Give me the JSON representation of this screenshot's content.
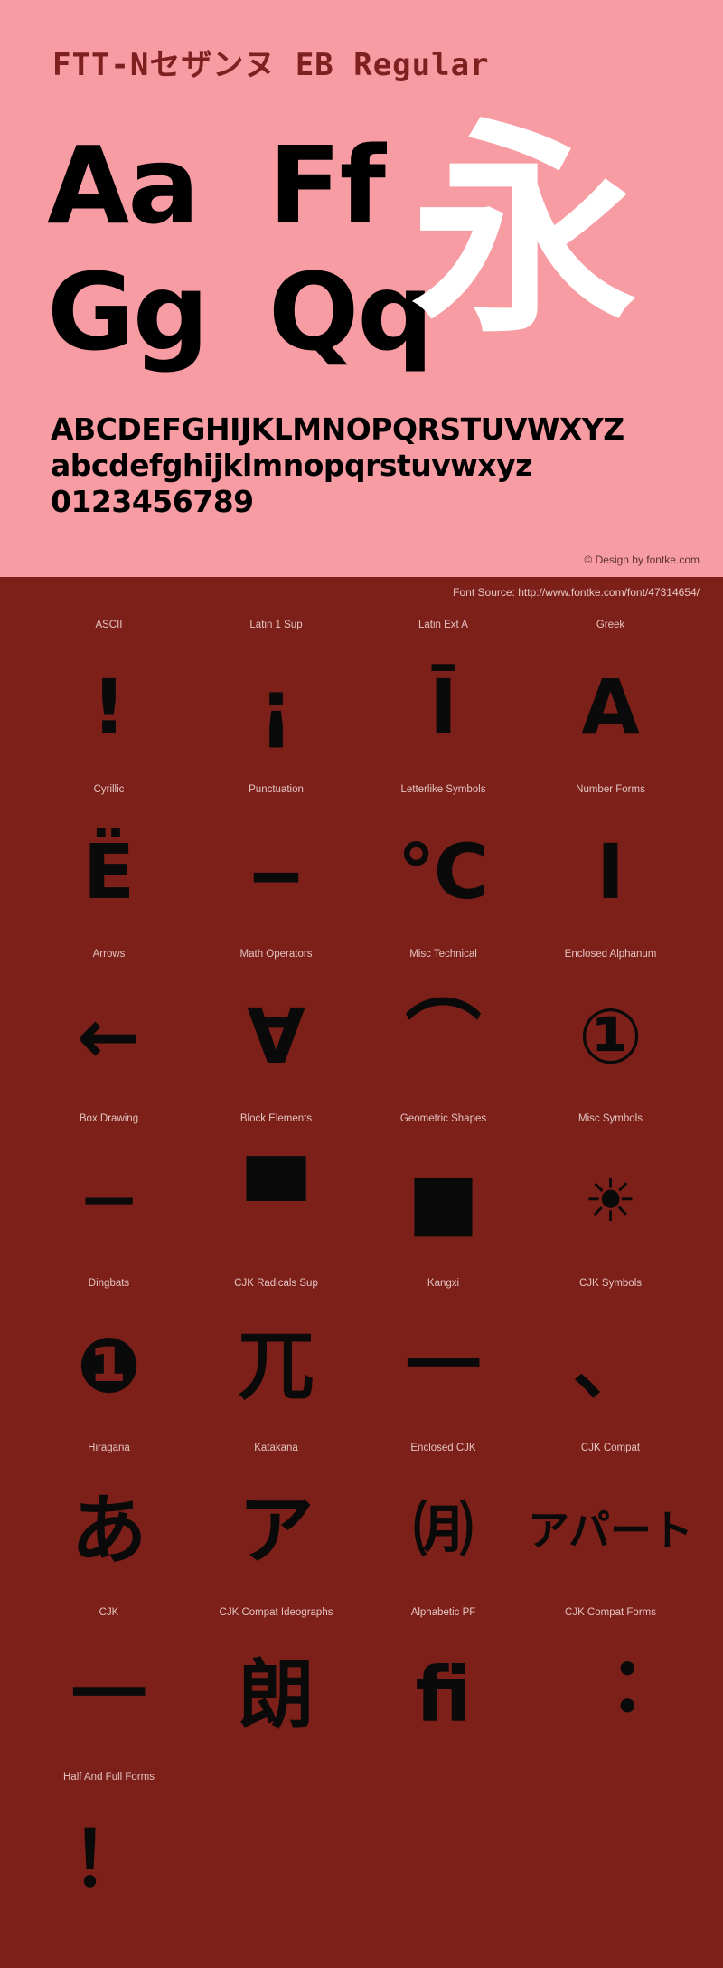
{
  "specimen": {
    "title": "FTT-Nセザンヌ EB Regular",
    "samples": [
      {
        "pair1": "Aa",
        "pair2": "Ff"
      },
      {
        "pair1": "Gg",
        "pair2": "Qq"
      }
    ],
    "cjk_sample": "永",
    "uppercase": "ABCDEFGHIJKLMNOPQRSTUVWXYZ",
    "lowercase": "abcdefghijklmnopqrstuvwxyz",
    "digits": "0123456789",
    "copyright": "© Design by fontke.com",
    "colors": {
      "background": "#f79ca3",
      "title_text": "#7e2020",
      "glyph_black": "#000000",
      "glyph_white": "#ffffff"
    }
  },
  "blocks_section": {
    "font_source": "Font Source: http://www.fontke.com/font/47314654/",
    "colors": {
      "background": "#7c2019",
      "label_text": "#e3c3c1",
      "glyph": "#0a0a0a"
    },
    "cells": [
      {
        "label": "ASCII",
        "glyph": "!",
        "size": "normal"
      },
      {
        "label": "Latin 1 Sup",
        "glyph": "¡",
        "size": "normal"
      },
      {
        "label": "Latin Ext A",
        "glyph": "Ī",
        "size": "normal"
      },
      {
        "label": "Greek",
        "glyph": "Α",
        "size": "normal"
      },
      {
        "label": "Cyrillic",
        "glyph": "Ё",
        "size": "normal"
      },
      {
        "label": "Punctuation",
        "glyph": "‒",
        "size": "normal"
      },
      {
        "label": "Letterlike Symbols",
        "glyph": "℃",
        "size": "normal"
      },
      {
        "label": "Number Forms",
        "glyph": "Ⅰ",
        "size": "normal"
      },
      {
        "label": "Arrows",
        "glyph": "←",
        "size": "normal"
      },
      {
        "label": "Math Operators",
        "glyph": "∀",
        "size": "normal"
      },
      {
        "label": "Misc Technical",
        "glyph": "⌒",
        "size": "normal"
      },
      {
        "label": "Enclosed Alphanum",
        "glyph": "①",
        "size": "normal"
      },
      {
        "label": "Box Drawing",
        "glyph": "─",
        "size": "normal"
      },
      {
        "label": "Block Elements",
        "glyph": "▀",
        "size": "normal"
      },
      {
        "label": "Geometric Shapes",
        "glyph": "■",
        "size": "normal"
      },
      {
        "label": "Misc Symbols",
        "glyph": "☀",
        "size": "smaller"
      },
      {
        "label": "Dingbats",
        "glyph": "❶",
        "size": "normal"
      },
      {
        "label": "CJK Radicals Sup",
        "glyph": "⺎",
        "size": "normal"
      },
      {
        "label": "Kangxi",
        "glyph": "⼀",
        "size": "normal"
      },
      {
        "label": "CJK Symbols",
        "glyph": "、",
        "size": "normal"
      },
      {
        "label": "Hiragana",
        "glyph": "あ",
        "size": "normal"
      },
      {
        "label": "Katakana",
        "glyph": "ア",
        "size": "normal"
      },
      {
        "label": "Enclosed CJK",
        "glyph": "㈪",
        "size": "smaller"
      },
      {
        "label": "CJK Compat",
        "glyph": "アパート",
        "size": "dual"
      },
      {
        "label": "CJK",
        "glyph": "一",
        "size": "normal"
      },
      {
        "label": "CJK Compat Ideographs",
        "glyph": "朗",
        "size": "normal"
      },
      {
        "label": "Alphabetic PF",
        "glyph": "ﬁ",
        "size": "normal"
      },
      {
        "label": "CJK Compat Forms",
        "glyph": "︓",
        "size": "normal"
      },
      {
        "label": "Half And Full Forms",
        "glyph": "！",
        "size": "normal"
      }
    ]
  }
}
